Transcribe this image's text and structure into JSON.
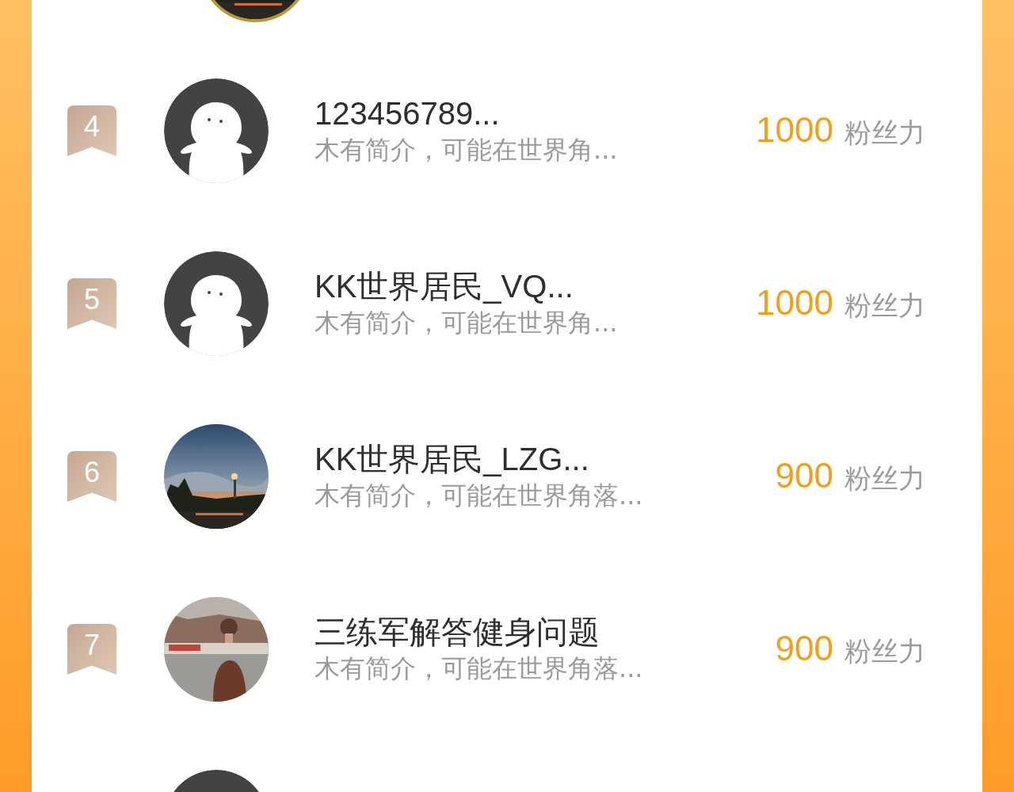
{
  "rows": [
    {
      "rank": "4",
      "avatar": {
        "kind": "default"
      },
      "name": "123456789...",
      "bio": "木有简介，可能在世界角...",
      "score": "1000",
      "score_label": "粉丝力"
    },
    {
      "rank": "5",
      "avatar": {
        "kind": "default"
      },
      "name": "KK世界居民_VQ...",
      "bio": "木有简介，可能在世界角...",
      "score": "1000",
      "score_label": "粉丝力"
    },
    {
      "rank": "6",
      "name": "KK世界居民_LZG...",
      "bio": "木有简介，可能在世界角落...",
      "score": "900",
      "score_label": "粉丝力"
    },
    {
      "rank": "7",
      "name": "三练军解答健身问题",
      "bio": "木有简介，可能在世界角落...",
      "score": "900",
      "score_label": "粉丝力"
    }
  ],
  "bottom_avatar": {
    "kind": "default"
  }
}
